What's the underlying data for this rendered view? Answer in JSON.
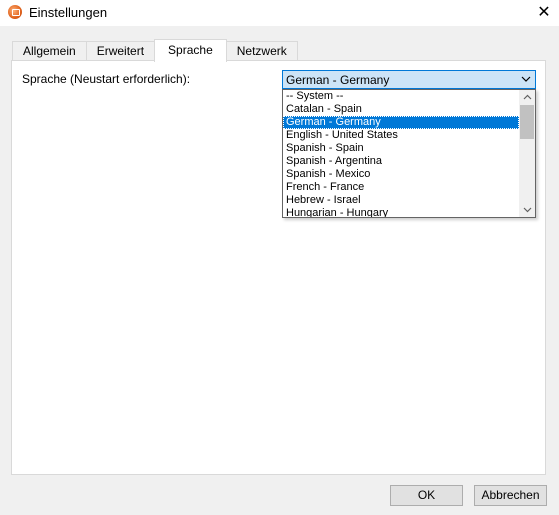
{
  "window": {
    "title": "Einstellungen",
    "close_glyph": "✕"
  },
  "tabs": [
    {
      "label": "Allgemein",
      "active": false
    },
    {
      "label": "Erweitert",
      "active": false
    },
    {
      "label": "Sprache",
      "active": true
    },
    {
      "label": "Netzwerk",
      "active": false
    }
  ],
  "language": {
    "label": "Sprache (Neustart erforderlich):",
    "selected": "German - Germany",
    "options": [
      "-- System --",
      "Catalan - Spain",
      "German - Germany",
      "English - United States",
      "Spanish - Spain",
      "Spanish - Argentina",
      "Spanish - Mexico",
      "French - France",
      "Hebrew - Israel",
      "Hungarian - Hungary"
    ],
    "selected_index": 2
  },
  "buttons": {
    "ok": "OK",
    "cancel": "Abbrechen"
  },
  "colors": {
    "accent": "#0078d7",
    "combo_background": "#cce4f7"
  },
  "icons": {
    "app": "app-icon",
    "close": "close-icon",
    "combo_arrow": "chevron-down-icon",
    "scroll_up": "chevron-up-icon",
    "scroll_down": "chevron-down-icon"
  }
}
